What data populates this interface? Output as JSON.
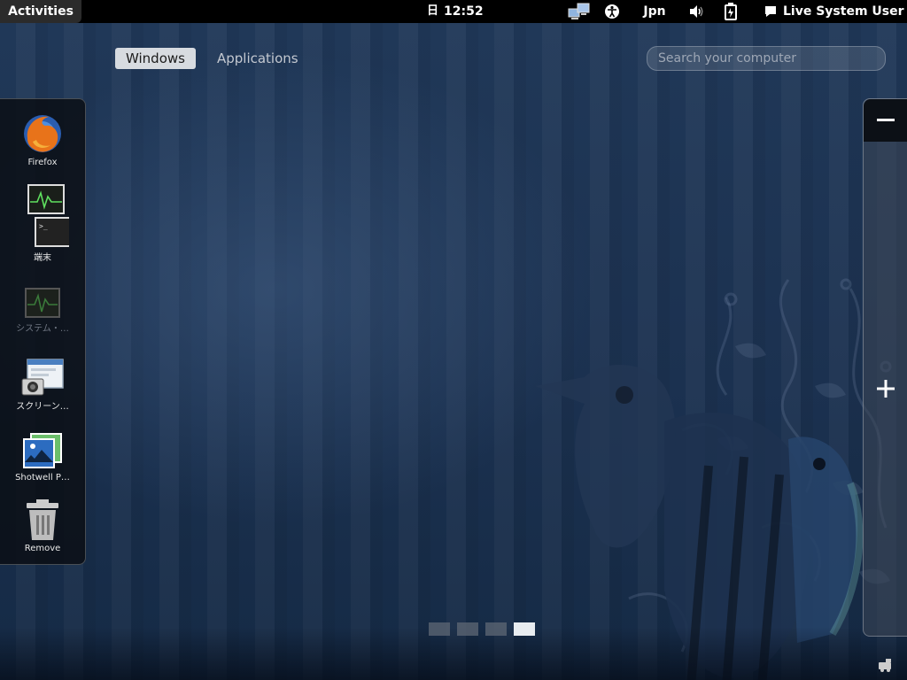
{
  "top_bar": {
    "activities_label": "Activities",
    "clock_day": "日",
    "clock_time": "12:52",
    "keyboard_layout": "Jpn",
    "user_name": "Live System User"
  },
  "overview": {
    "tabs": [
      {
        "label": "Windows",
        "active": true
      },
      {
        "label": "Applications",
        "active": false
      }
    ],
    "search_placeholder": "Search your computer"
  },
  "dash": {
    "items": [
      {
        "label": "Firefox",
        "icon": "firefox-icon"
      },
      {
        "label": "端末",
        "icon": "terminal-icon"
      },
      {
        "label": "システム・…",
        "icon": "system-monitor-icon"
      },
      {
        "label": "スクリーン…",
        "icon": "screenshot-icon"
      },
      {
        "label": "Shotwell P…",
        "icon": "shotwell-icon"
      },
      {
        "label": "Remove",
        "icon": "trash-icon"
      }
    ]
  },
  "workspaces": {
    "count": 4,
    "active_index": 3
  },
  "colors": {
    "top_bar": "#000000",
    "desktop": "#1d3250",
    "tab_active_bg": "#d7dbe0"
  }
}
